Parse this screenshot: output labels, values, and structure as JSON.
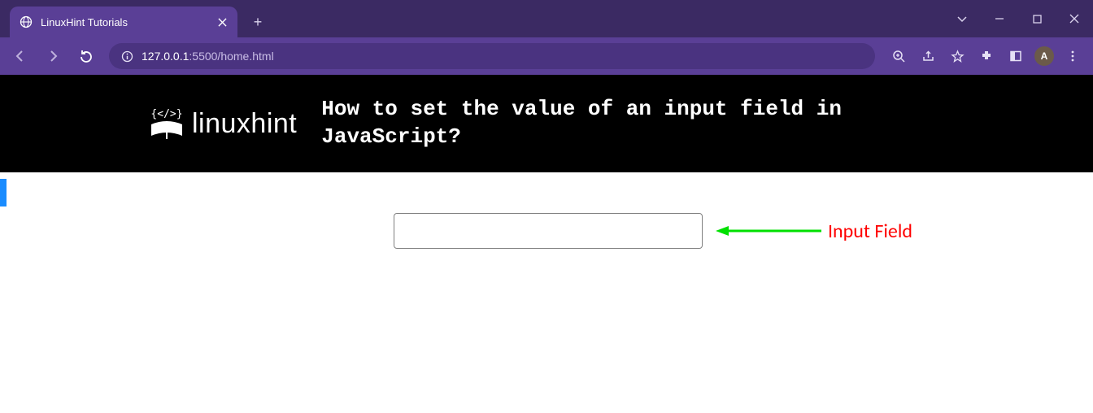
{
  "browser": {
    "tab_title": "LinuxHint Tutorials",
    "new_tab_glyph": "+",
    "url_host": "127.0.0.1",
    "url_port_path": ":5500/home.html",
    "avatar_initial": "A"
  },
  "page": {
    "logo_text": "linuxhint",
    "heading": "How to set the value of an input field in JavaScript?",
    "input_value": "",
    "annotation_label": "Input Field"
  },
  "colors": {
    "arrow": "#00e000",
    "annotation": "#ff0000"
  }
}
